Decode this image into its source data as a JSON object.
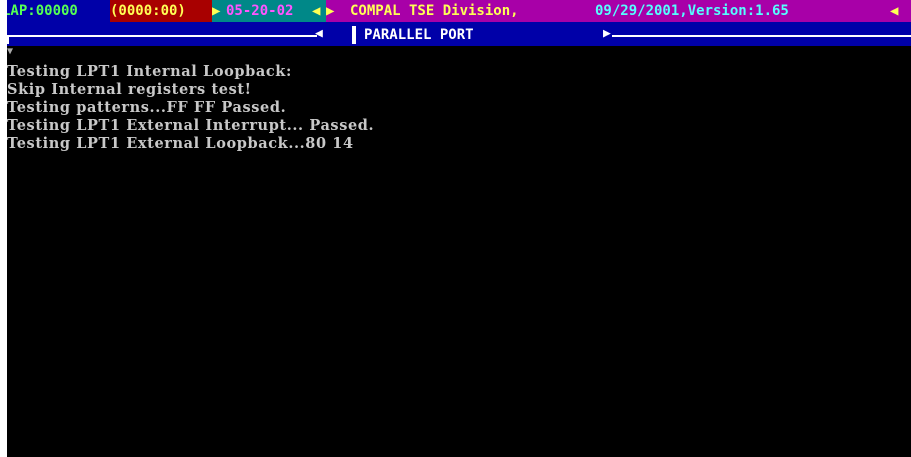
{
  "status_bar": {
    "lap": "LAP:00000",
    "timer": "(0000:00)",
    "date": "05-20-02",
    "company": "COMPAL TSE Division,",
    "build": "09/29/2001,Version:1.65",
    "arrow_right": "▶",
    "arrow_left": "◀"
  },
  "title_bar": {
    "title": "PARALLEL PORT",
    "arrow_left": "◀",
    "arrow_right": "▶"
  },
  "scroll_marker": "▼",
  "console": {
    "lines": [
      "Testing LPT1 Internal Loopback:",
      "Skip Internal registers test!",
      "Testing patterns...FF FF Passed.",
      "Testing LPT1 External Interrupt... Passed.",
      "Testing LPT1 External Loopback...80 14"
    ]
  },
  "colors": {
    "background": "#000000",
    "status_bar": "#a800a8",
    "title_bar": "#0000a8",
    "text": "#c8c8c8"
  }
}
